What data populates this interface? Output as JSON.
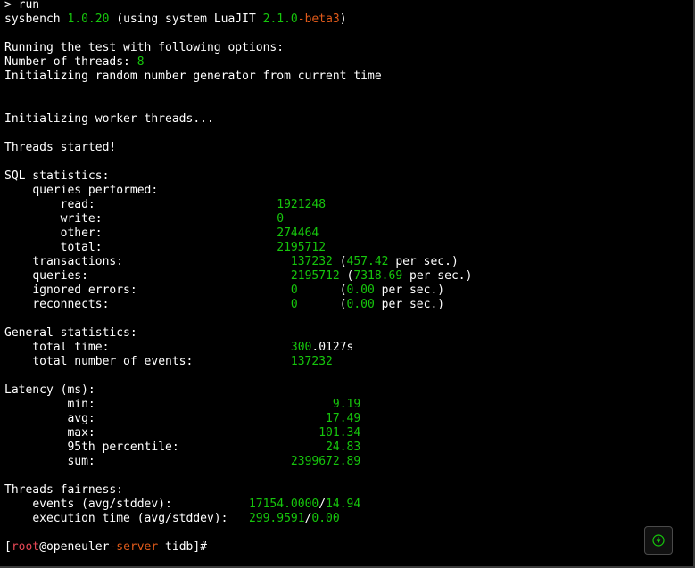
{
  "prompt_run": "> run",
  "sysbench": {
    "name": "sysbench",
    "version": "1.0.20",
    "using_prefix": "(using system LuaJIT",
    "luajit_version": "2.1.0",
    "luajit_suffix": "-beta3",
    "close": ")"
  },
  "intro": {
    "running": "Running the test with following options:",
    "threads_label": "Number of threads:",
    "threads_value": "8",
    "init_rng": "Initializing random number generator from current time",
    "init_workers": "Initializing worker threads...",
    "threads_started": "Threads started!"
  },
  "sql": {
    "header": "SQL statistics:",
    "queries_performed": "queries performed:",
    "read_label": "read:",
    "read_value": "1921248",
    "write_label": "write:",
    "write_value": "0",
    "other_label": "other:",
    "other_value": "274464",
    "total_label": "total:",
    "total_value": "2195712",
    "transactions_label": "transactions:",
    "transactions_value": "137232",
    "transactions_rate": "457.42",
    "queries_label": "queries:",
    "queries_value": "2195712",
    "queries_rate": "7318.69",
    "ignored_label": "ignored errors:",
    "ignored_value": "0",
    "ignored_rate": "0.00",
    "reconnects_label": "reconnects:",
    "reconnects_value": "0",
    "reconnects_rate": "0.00",
    "per_sec": "per sec.",
    "paren_open": "(",
    "paren_close": ")"
  },
  "general": {
    "header": "General statistics:",
    "total_time_label": "total time:",
    "total_time_value": "300",
    "total_time_fraction": ".0127s",
    "events_label": "total number of events:",
    "events_value": "137232"
  },
  "latency": {
    "header": "Latency (ms):",
    "min_label": "min:",
    "min_value": "9.19",
    "avg_label": "avg:",
    "avg_value": "17.49",
    "max_label": "max:",
    "max_value": "101.34",
    "p95_label": "95th percentile:",
    "p95_value": "24.83",
    "sum_label": "sum:",
    "sum_value": "2399672.89"
  },
  "fairness": {
    "header": "Threads fairness:",
    "events_label": "events (avg/stddev):",
    "events_avg": "17154.0000",
    "events_stddev": "14.94",
    "exec_label": "execution time (avg/stddev):",
    "exec_avg": "299.9591",
    "exec_stddev": "0.00",
    "slash": "/"
  },
  "shell_prompt": {
    "open": "[",
    "user": "root",
    "at": "@",
    "host_a": "openeuler",
    "host_b": "-server",
    "path": " tidb",
    "close": "]#"
  },
  "colors": {
    "background": "#000000",
    "text": "#ffffff",
    "green": "#16c60c",
    "orange": "#e05a1a",
    "red": "#e74856"
  },
  "icons": {
    "fab": "lightning-bolt-icon"
  }
}
